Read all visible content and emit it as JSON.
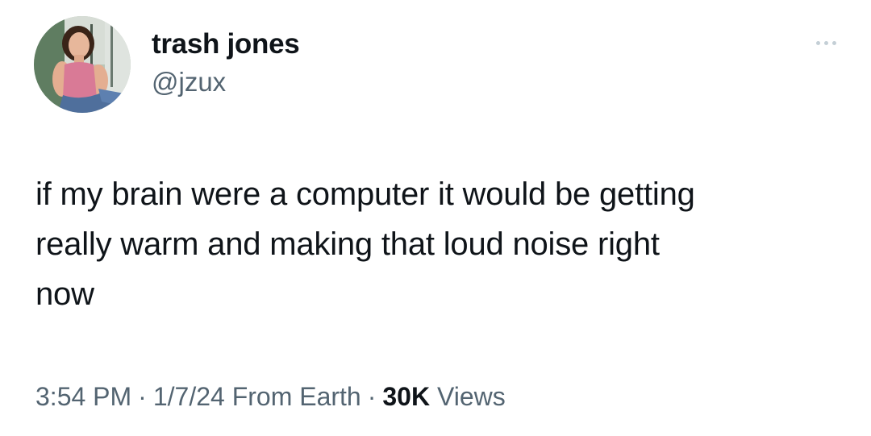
{
  "author": {
    "display_name": "trash jones",
    "handle": "@jzux",
    "avatar_icon": "profile-photo"
  },
  "more_icon": "ellipsis-icon",
  "tweet": {
    "lines": [
      "if my brain were a computer it would be getting",
      "really warm and making that loud noise right",
      "now"
    ]
  },
  "meta": {
    "time": "3:54 PM",
    "separator": "·",
    "date": "1/7/24",
    "source": "From Earth",
    "views_count": "30K",
    "views_label": "Views"
  },
  "colors": {
    "text_primary": "#0f1419",
    "text_secondary": "#536471",
    "background": "#ffffff"
  }
}
